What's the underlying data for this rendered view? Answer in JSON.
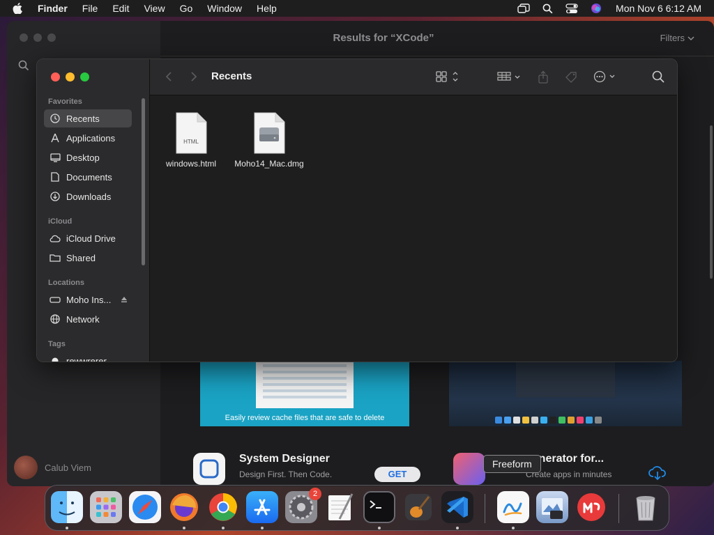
{
  "menubar": {
    "app_name": "Finder",
    "items": [
      "File",
      "Edit",
      "View",
      "Go",
      "Window",
      "Help"
    ],
    "clock": "Mon Nov 6  6:12 AM"
  },
  "store": {
    "title": "Results for “XCode”",
    "filters": "Filters",
    "user_name": "Calub Viem",
    "screenshot_caption": "Easily review cache files that are safe to delete",
    "listing1": {
      "name": "System Designer",
      "subtitle": "Design First. Then Code.",
      "get_label": "GET"
    },
    "listing2": {
      "name": "generator for...",
      "subtitle": "Create apps in minutes"
    }
  },
  "finder": {
    "title": "Recents",
    "sections": {
      "favorites": "Favorites",
      "icloud": "iCloud",
      "locations": "Locations",
      "tags": "Tags"
    },
    "favorites": [
      {
        "label": "Recents",
        "icon": "clock-icon",
        "active": true
      },
      {
        "label": "Applications",
        "icon": "applications-icon"
      },
      {
        "label": "Desktop",
        "icon": "desktop-icon"
      },
      {
        "label": "Documents",
        "icon": "document-icon"
      },
      {
        "label": "Downloads",
        "icon": "download-icon"
      }
    ],
    "icloud": [
      {
        "label": "iCloud Drive",
        "icon": "cloud-icon"
      },
      {
        "label": "Shared",
        "icon": "shared-folder-icon"
      }
    ],
    "locations": [
      {
        "label": "Moho Ins...",
        "icon": "drive-icon"
      },
      {
        "label": "Network",
        "icon": "globe-icon"
      }
    ],
    "tags": [
      {
        "label": "rewwrerer"
      }
    ],
    "files": [
      {
        "name": "windows.html",
        "badge": "HTML",
        "icon": "html-file-icon"
      },
      {
        "name": "Moho14_Mac.dmg",
        "icon": "disk-image-icon"
      }
    ]
  },
  "dock": {
    "tooltip": "Freeform",
    "badge_count": "2"
  },
  "colors": {
    "close": "#ff5f57",
    "minimize": "#febc2e",
    "zoom": "#28c840",
    "accent": "#1f6fe0"
  }
}
